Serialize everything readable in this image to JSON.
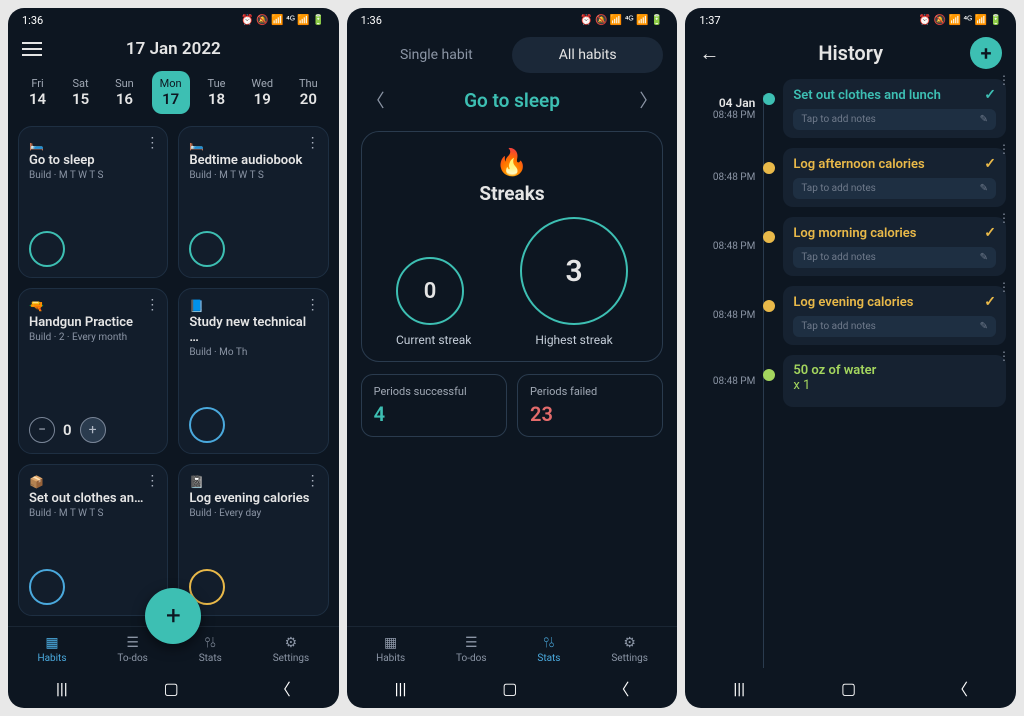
{
  "status_time1": "1:36",
  "status_time2": "1:36",
  "status_time3": "1:37",
  "status_icons_right": "⏰ 🔕 📶 ⁴ᴳᶻ ⬆ 📶 🔋",
  "screen1": {
    "date_title": "17 Jan 2022",
    "days": [
      {
        "dow": "Fri",
        "num": "14"
      },
      {
        "dow": "Sat",
        "num": "15"
      },
      {
        "dow": "Sun",
        "num": "16"
      },
      {
        "dow": "Mon",
        "num": "17",
        "sel": true
      },
      {
        "dow": "Tue",
        "num": "18"
      },
      {
        "dow": "Wed",
        "num": "19"
      },
      {
        "dow": "Thu",
        "num": "20"
      }
    ],
    "habits": [
      {
        "emoji": "🛏️",
        "title": "Go to sleep",
        "sub": "Build · M T W T S",
        "color": "#3dbfb3"
      },
      {
        "emoji": "🛏️",
        "title": "Bedtime audiobook",
        "sub": "Build · M T W T S",
        "color": "#3dbfb3"
      },
      {
        "emoji": "🔫",
        "title": "Handgun Practice",
        "sub": "Build · 2 · Every month",
        "counter": 0,
        "color": "#3dbfb3"
      },
      {
        "emoji": "📘",
        "title": "Study new technical …",
        "sub": "Build · Mo Th",
        "color": "#4aa9dd"
      },
      {
        "emoji": "📦",
        "title": "Set out clothes an…",
        "sub": "Build · M T W T S",
        "color": "#4aa9dd"
      },
      {
        "emoji": "📓",
        "title": "Log evening calories",
        "sub": "Build · Every day",
        "color": "#e9b949"
      }
    ],
    "nav": [
      "Habits",
      "To-dos",
      "Stats",
      "Settings"
    ],
    "nav_active": 0
  },
  "screen2": {
    "tabs": [
      "Single habit",
      "All habits"
    ],
    "tab_active": 1,
    "habit_name": "Go to sleep",
    "streak_title": "Streaks",
    "current_streak": "0",
    "current_label": "Current streak",
    "highest_streak": "3",
    "highest_label": "Highest streak",
    "periods_success_label": "Periods successful",
    "periods_success_val": "4",
    "periods_fail_label": "Periods failed",
    "periods_fail_val": "23",
    "nav": [
      "Habits",
      "To-dos",
      "Stats",
      "Settings"
    ],
    "nav_active": 2
  },
  "screen3": {
    "title": "History",
    "date": "04 Jan",
    "items": [
      {
        "time": "08:48 PM",
        "title": "Set out clothes and lunch",
        "color": "#3dbfb3",
        "tcolor": "#3dbfb3",
        "notes": "Tap to add notes",
        "show_date": true
      },
      {
        "time": "08:48 PM",
        "title": "Log afternoon calories",
        "color": "#e9b949",
        "tcolor": "#e9b949",
        "notes": "Tap to add notes"
      },
      {
        "time": "08:48 PM",
        "title": "Log morning calories",
        "color": "#e9b949",
        "tcolor": "#e9b949",
        "notes": "Tap to add notes"
      },
      {
        "time": "08:48 PM",
        "title": "Log evening calories",
        "color": "#e9b949",
        "tcolor": "#e9b949",
        "notes": "Tap to add notes"
      },
      {
        "time": "08:48 PM",
        "title": "50 oz of water",
        "subtitle": "x 1",
        "color": "#a4d65e",
        "tcolor": "#a4d65e",
        "no_check": true
      }
    ]
  }
}
